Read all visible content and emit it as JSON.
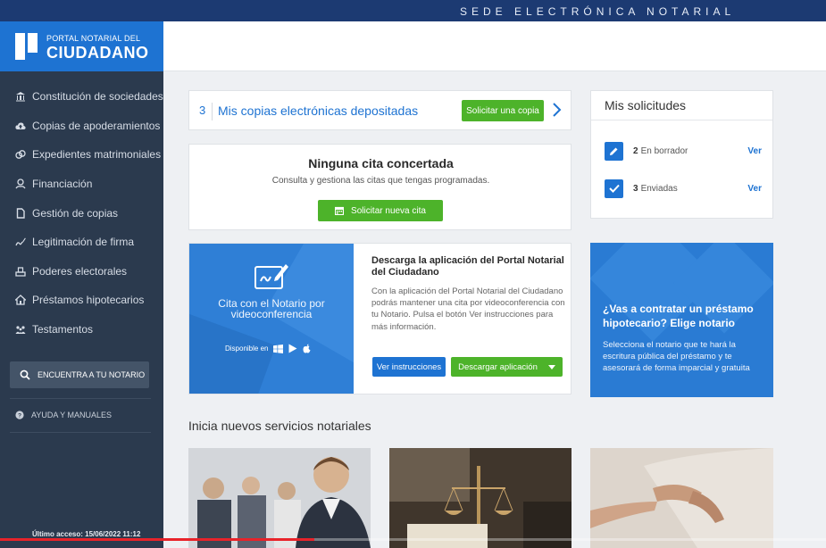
{
  "topbar": {
    "title": "SEDE ELECTRÓNICA NOTARIAL"
  },
  "logo": {
    "small": "PORTAL NOTARIAL DEL",
    "big": "CIUDADANO"
  },
  "sidebar": {
    "items": [
      {
        "label": "Constitución de sociedades",
        "icon": "building-icon"
      },
      {
        "label": "Copias de apoderamientos",
        "icon": "cloud-upload-icon"
      },
      {
        "label": "Expedientes matrimoniales",
        "icon": "rings-icon"
      },
      {
        "label": "Financiación",
        "icon": "finance-icon"
      },
      {
        "label": "Gestión de copias",
        "icon": "document-icon"
      },
      {
        "label": "Legitimación de firma",
        "icon": "signature-icon"
      },
      {
        "label": "Poderes electorales",
        "icon": "ballot-icon"
      },
      {
        "label": "Préstamos hipotecarios",
        "icon": "house-icon"
      },
      {
        "label": "Testamentos",
        "icon": "family-icon"
      }
    ],
    "find_notary": "ENCUENTRA A TU NOTARIO",
    "help": "AYUDA Y MANUALES",
    "last_access": "Último acceso: 15/06/2022 11:12"
  },
  "copies": {
    "count": "3",
    "title": "Mis copias electrónicas depositadas",
    "button": "Solicitar una copia"
  },
  "appointment": {
    "title": "Ninguna cita concertada",
    "subtitle": "Consulta y gestiona las citas que tengas programadas.",
    "button": "Solicitar nueva cita"
  },
  "requests": {
    "title": "Mis solicitudes",
    "rows": [
      {
        "count": "2",
        "label": "En borrador",
        "link": "Ver"
      },
      {
        "count": "3",
        "label": "Enviadas",
        "link": "Ver"
      }
    ]
  },
  "app_promo": {
    "blue_text": "Cita con el Notario por videoconferencia",
    "available": "Disponible en",
    "title": "Descarga la aplicación del Portal Notarial del Ciudadano",
    "body": "Con la aplicación del Portal Notarial del Ciudadano podrás mantener una cita por videoconferencia con tu Notario. Pulsa el botón Ver instrucciones para más información.",
    "btn_instructions": "Ver instrucciones",
    "btn_download": "Descargar aplicación"
  },
  "loan": {
    "title": "¿Vas a contratar un préstamo hipotecario? Elige notario",
    "body": "Selecciona el notario que te hará la escritura pública del préstamo y te asesorará de forma imparcial y gratuita"
  },
  "services": {
    "title": "Inicia nuevos servicios notariales"
  },
  "video": {
    "progress": 0.38
  },
  "colors": {
    "brand_blue": "#1e73d2",
    "green": "#4db32a",
    "sidebar": "#2b3a4e",
    "topbar": "#1c3a72"
  }
}
